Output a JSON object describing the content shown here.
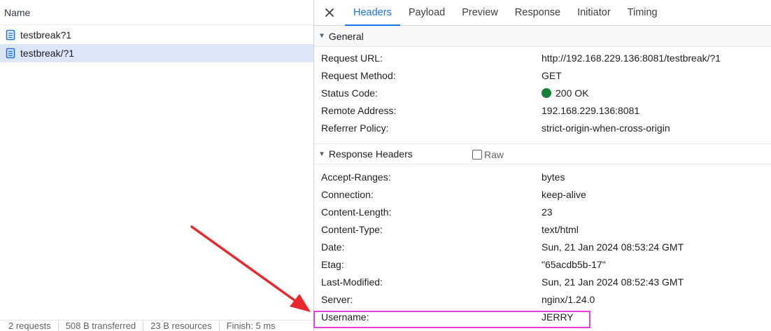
{
  "left": {
    "header": "Name",
    "requests": [
      {
        "name": "testbreak?1",
        "selected": false
      },
      {
        "name": "testbreak/?1",
        "selected": true
      }
    ],
    "status": {
      "requests": "2 requests",
      "transferred": "508 B transferred",
      "resources": "23 B resources",
      "finish": "Finish: 5 ms"
    }
  },
  "tabs": [
    "Headers",
    "Payload",
    "Preview",
    "Response",
    "Initiator",
    "Timing"
  ],
  "active_tab": "Headers",
  "general": {
    "title": "General",
    "rows": [
      {
        "key": "Request URL:",
        "value": "http://192.168.229.136:8081/testbreak/?1"
      },
      {
        "key": "Request Method:",
        "value": "GET"
      },
      {
        "key": "Status Code:",
        "value": "200 OK"
      },
      {
        "key": "Remote Address:",
        "value": "192.168.229.136:8081"
      },
      {
        "key": "Referrer Policy:",
        "value": "strict-origin-when-cross-origin"
      }
    ]
  },
  "response_headers": {
    "title": "Response Headers",
    "raw_label": "Raw",
    "raw_checked": false,
    "rows": [
      {
        "key": "Accept-Ranges:",
        "value": "bytes"
      },
      {
        "key": "Connection:",
        "value": "keep-alive"
      },
      {
        "key": "Content-Length:",
        "value": "23"
      },
      {
        "key": "Content-Type:",
        "value": "text/html"
      },
      {
        "key": "Date:",
        "value": "Sun, 21 Jan 2024 08:53:24 GMT"
      },
      {
        "key": "Etag:",
        "value": "\"65acdb5b-17\""
      },
      {
        "key": "Last-Modified:",
        "value": "Sun, 21 Jan 2024 08:52:43 GMT"
      },
      {
        "key": "Server:",
        "value": "nginx/1.24.0"
      },
      {
        "key": "Username:",
        "value": "JERRY"
      }
    ]
  },
  "colors": {
    "accent": "#1a73e8",
    "selected_row": "#dbe6f9",
    "status_ok": "#188038",
    "highlight_box": "#e83ee0",
    "arrow": "#e8282c"
  },
  "icons": {
    "close": "close-icon",
    "document": "document-icon",
    "triangle": "triangle-down-icon"
  }
}
